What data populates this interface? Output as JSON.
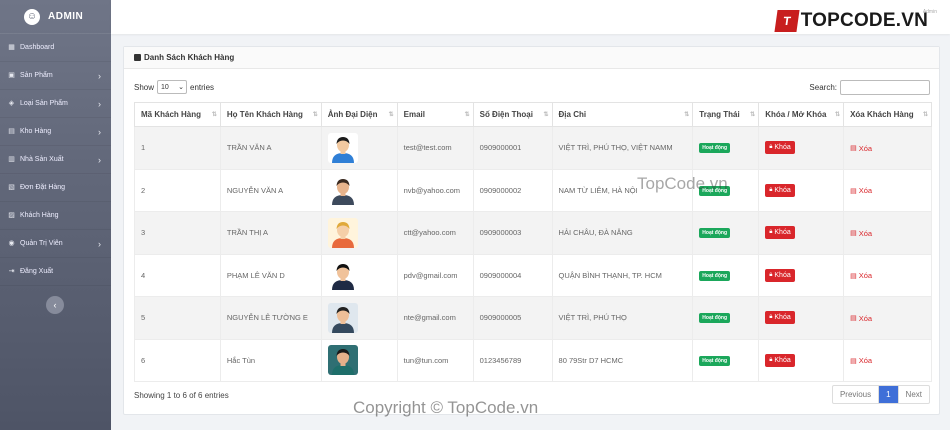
{
  "brand": {
    "title": "ADMIN"
  },
  "topbar": {
    "logo_text": "TOPCODE.VN",
    "logo_mark": "T",
    "user_text": "Admin"
  },
  "sidebar": {
    "items": [
      {
        "label": "Dashboard",
        "icon": "grid-icon",
        "has_children": false
      },
      {
        "label": "Sản Phẩm",
        "icon": "box-icon",
        "has_children": true
      },
      {
        "label": "Loại Sản Phẩm",
        "icon": "tag-icon",
        "has_children": true
      },
      {
        "label": "Kho Hàng",
        "icon": "warehouse-icon",
        "has_children": true
      },
      {
        "label": "Nhà Sản Xuất",
        "icon": "factory-icon",
        "has_children": true
      },
      {
        "label": "Đơn Đặt Hàng",
        "icon": "cart-icon",
        "has_children": false
      },
      {
        "label": "Khách Hàng",
        "icon": "users-icon",
        "has_children": false
      },
      {
        "label": "Quản Trị Viên",
        "icon": "admin-icon",
        "has_children": true
      },
      {
        "label": "Đăng Xuất",
        "icon": "logout-icon",
        "has_children": false
      }
    ],
    "collapse_glyph": "‹"
  },
  "card": {
    "title": "Danh Sách Khách Hàng",
    "show_label": "Show",
    "entries_value": "10",
    "entries_label": "entries",
    "search_label": "Search:",
    "search_value": "",
    "columns": [
      "Mã Khách Hàng",
      "Họ Tên Khách Hàng",
      "Ảnh Đại Diện",
      "Email",
      "Số Điện Thoại",
      "Địa Chỉ",
      "Trạng Thái",
      "Khóa / Mở Khóa",
      "Xóa Khách Hàng"
    ],
    "rows": [
      {
        "id": "1",
        "name": "TRẦN VĂN A",
        "email": "test@test.com",
        "phone": "0909000001",
        "address": "VIỆT TRÌ, PHÚ THỌ, VIỆT NAMM",
        "status": "Hoạt động",
        "lock": "Khóa",
        "delete": "Xóa",
        "avatar": {
          "skin": "#f2c9a0",
          "hair": "#1c1c1c",
          "shirt": "#2f7fd6",
          "bg": "#ffffff"
        }
      },
      {
        "id": "2",
        "name": "NGUYỄN VĂN A",
        "email": "nvb@yahoo.com",
        "phone": "0909000002",
        "address": "NAM TỪ LIÊM, HÀ NỘI",
        "status": "Hoạt động",
        "lock": "Khóa",
        "delete": "Xóa",
        "avatar": {
          "skin": "#e8b48c",
          "hair": "#3a2a20",
          "shirt": "#3d4a5c",
          "bg": "#ffffff"
        }
      },
      {
        "id": "3",
        "name": "TRẦN THỊ A",
        "email": "ctt@yahoo.com",
        "phone": "0909000003",
        "address": "HẢI CHÂU, ĐÀ NẴNG",
        "status": "Hoạt động",
        "lock": "Khóa",
        "delete": "Xóa",
        "avatar": {
          "skin": "#f5cfa8",
          "hair": "#e0a93a",
          "shirt": "#e86a3c",
          "bg": "#fff4dc"
        }
      },
      {
        "id": "4",
        "name": "PHẠM LÊ VĂN D",
        "email": "pdv@gmail.com",
        "phone": "0909000004",
        "address": "QUẬN BÌNH THẠNH, TP. HCM",
        "status": "Hoạt động",
        "lock": "Khóa",
        "delete": "Xóa",
        "avatar": {
          "skin": "#f0c29a",
          "hair": "#111111",
          "shirt": "#1f2a44",
          "bg": "#ffffff"
        }
      },
      {
        "id": "5",
        "name": "NGUYỄN LÊ TƯỜNG E",
        "email": "nte@gmail.com",
        "phone": "0909000005",
        "address": "VIỆT TRÌ, PHÚ THỌ",
        "status": "Hoạt động",
        "lock": "Khóa",
        "delete": "Xóa",
        "avatar": {
          "skin": "#eebf98",
          "hair": "#222222",
          "shirt": "#34495e",
          "bg": "#dfe7ee"
        }
      },
      {
        "id": "6",
        "name": "Hắc Tùn",
        "email": "tun@tun.com",
        "phone": "0123456789",
        "address": "80 79Str D7 HCMC",
        "status": "Hoạt động",
        "lock": "Khóa",
        "delete": "Xóa",
        "avatar": {
          "skin": "#e5b08a",
          "hair": "#1a1a1a",
          "shirt": "#1e6e6a",
          "bg": "#2f6f73"
        }
      }
    ],
    "footer_info": "Showing 1 to 6 of 6 entries",
    "pager": {
      "previous": "Previous",
      "current": "1",
      "next": "Next"
    }
  },
  "watermarks": {
    "center": "TopCode.vn",
    "bottom": "Copyright © TopCode.vn"
  },
  "colors": {
    "sidebar": "#5b6173",
    "status_green": "#1ba75b",
    "danger_red": "#d9262b",
    "pager_active": "#3f6fd8"
  }
}
